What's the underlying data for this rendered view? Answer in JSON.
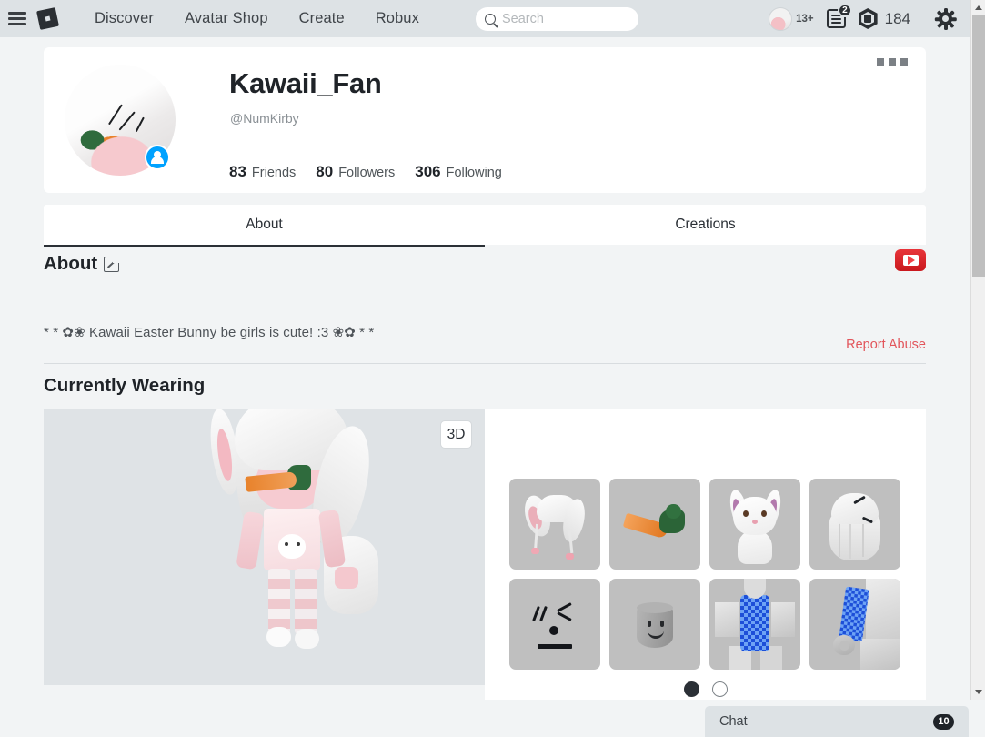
{
  "topnav": {
    "menu_icon": "hamburger-menu-icon",
    "logo": "roblox-logo-icon",
    "links": [
      {
        "label": "Discover"
      },
      {
        "label": "Avatar Shop"
      },
      {
        "label": "Create"
      },
      {
        "label": "Robux"
      }
    ],
    "search": {
      "placeholder": "Search",
      "value": "",
      "icon": "search-icon"
    },
    "age_badge": "13+",
    "messages": {
      "icon": "messages-icon",
      "count": "2"
    },
    "robux": {
      "icon": "robux-icon",
      "amount": "184"
    },
    "settings_icon": "gear-icon"
  },
  "profile": {
    "username": "Kawaii_Fan",
    "handle": "@NumKirby",
    "friend_badge_icon": "person-badge-icon",
    "avatar": "user-avatar-image",
    "menu_icon": "more-options-icon",
    "stats": [
      {
        "num": "83",
        "label": "Friends"
      },
      {
        "num": "80",
        "label": "Followers"
      },
      {
        "num": "306",
        "label": "Following"
      }
    ]
  },
  "tabs": [
    {
      "label": "About",
      "active": true
    },
    {
      "label": "Creations",
      "active": false
    }
  ],
  "about": {
    "title": "About",
    "edit_icon": "edit-pencil-icon",
    "text": "* * ✿❀ Kawaii Easter Bunny be girls is cute! :3 ❀✿ * *",
    "youtube_icon": "youtube-icon",
    "report_abuse": "Report Abuse"
  },
  "currently_wearing": {
    "title": "Currently Wearing",
    "view_3d_label": "3D",
    "avatar_preview": "avatar-3d-preview",
    "items": [
      {
        "name": "bunny-ears-hat-thumbnail"
      },
      {
        "name": "carrot-accessory-thumbnail"
      },
      {
        "name": "bunny-plush-shoulder-pal-thumbnail"
      },
      {
        "name": "white-hair-thumbnail"
      },
      {
        "name": "face-decal-thumbnail"
      },
      {
        "name": "classic-smile-head-thumbnail"
      },
      {
        "name": "blue-checkered-shirt-thumbnail"
      },
      {
        "name": "blue-checkered-sleeve-thumbnail"
      }
    ],
    "pagination": [
      {
        "active": true
      },
      {
        "active": false
      }
    ]
  },
  "chat": {
    "label": "Chat",
    "count": "10"
  },
  "colors": {
    "nav_bg": "#dde2e5",
    "page_bg": "#f2f4f5",
    "card_bg": "#ffffff",
    "accent_dark": "#2b3036",
    "friend_badge": "#00a2ff",
    "report_abuse": "#e2555b",
    "youtube_red": "#c9181d"
  }
}
